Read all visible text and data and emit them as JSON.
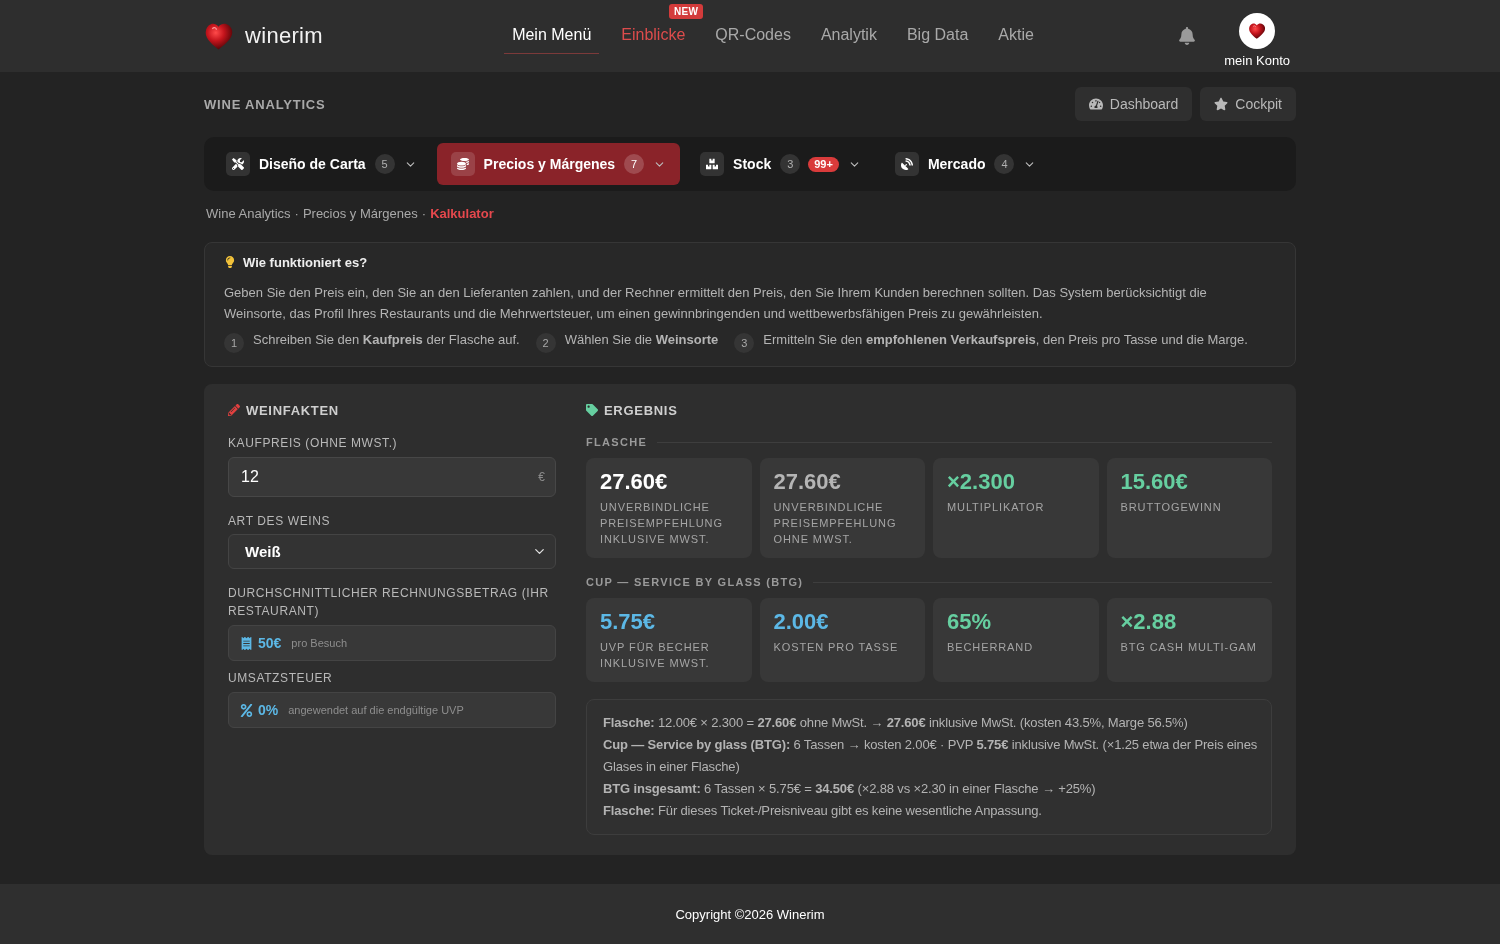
{
  "header": {
    "brand": "winerim",
    "nav": [
      {
        "label": "Mein Menü",
        "selected": true,
        "highlighted": false
      },
      {
        "label": "Einblicke",
        "selected": false,
        "highlighted": true,
        "badge": "NEW"
      },
      {
        "label": "QR-Codes",
        "selected": false,
        "highlighted": false
      },
      {
        "label": "Analytik",
        "selected": false,
        "highlighted": false
      },
      {
        "label": "Big Data",
        "selected": false,
        "highlighted": false
      },
      {
        "label": "Aktie",
        "selected": false,
        "highlighted": false
      }
    ],
    "account": "mein Konto"
  },
  "page": {
    "title": "WINE ANALYTICS",
    "actions": [
      "Dashboard",
      "Cockpit"
    ]
  },
  "tabs": [
    {
      "label": "Diseño de Carta",
      "count": "5",
      "selected": false
    },
    {
      "label": "Precios y Márgenes",
      "count": "7",
      "selected": true
    },
    {
      "label": "Stock",
      "count": "3",
      "alert": "99+",
      "selected": false
    },
    {
      "label": "Mercado",
      "count": "4",
      "selected": false
    }
  ],
  "breadcrumb": {
    "separator": "·",
    "items": [
      {
        "label": "Wine Analytics",
        "current": false
      },
      {
        "label": "Precios y Márgenes",
        "current": false
      },
      {
        "label": "Kalkulator",
        "current": true
      }
    ]
  },
  "info": {
    "title": "Wie funktioniert es?",
    "text": "Geben Sie den Preis ein, den Sie an den Lieferanten zahlen, und der Rechner ermittelt den Preis, den Sie Ihrem Kunden berechnen sollten. Das System berücksichtigt die Weinsorte, das Profil Ihres Restaurants und die Mehrwertsteuer, um einen gewinnbringenden und wettbewerbsfähigen Preis zu gewährleisten.",
    "steps": [
      {
        "number": "1",
        "text": "Schreiben Sie den **Kaufpreis** der Flasche auf."
      },
      {
        "number": "2",
        "text": "Wählen Sie die **Weinsorte**"
      },
      {
        "number": "3",
        "text": "Ermitteln Sie den **empfohlenen Verkaufspreis**, den Preis pro Tasse und die Marge."
      }
    ]
  },
  "form": {
    "title": "WEINFAKTEN",
    "fields": [
      {
        "kind": "input",
        "label": "KAUFPREIS (OHNE MWST.)",
        "value": "12",
        "suffix": "€"
      },
      {
        "kind": "select",
        "label": "ART DES WEINS",
        "value": "Weiß"
      },
      {
        "kind": "readout",
        "label": "DURCHSCHNITTLICHER RECHNUNGSBETRAG (IHR RESTAURANT)",
        "value": "50€",
        "note": "pro Besuch"
      },
      {
        "kind": "readout",
        "label": "UMSATZSTEUER",
        "value": "0%",
        "note": "angewendet auf die endgültige UVP"
      }
    ]
  },
  "result": {
    "title": "ERGEBNIS",
    "sections": [
      {
        "title": "FLASCHE",
        "metrics": [
          {
            "value": "27.60€",
            "label": "UNVERBINDLICHE PREISEMPFEHLUNG INKLUSIVE MWST.",
            "color": "#ffffff"
          },
          {
            "value": "27.60€",
            "label": "UNVERBINDLICHE PREISEMPFEHLUNG OHNE MWST.",
            "color": "#b4b4b4"
          },
          {
            "value": "×2.300",
            "label": "MULTIPLIKATOR",
            "color": "#66cfa0"
          },
          {
            "value": "15.60€",
            "label": "BRUTTOGEWINN",
            "color": "#66cfa0"
          }
        ]
      },
      {
        "title": "CUP — SERVICE BY GLASS (BTG)",
        "metrics": [
          {
            "value": "5.75€",
            "label": "UVP FÜR BECHER INKLUSIVE MWST.",
            "color": "#5cb8e6"
          },
          {
            "value": "2.00€",
            "label": "KOSTEN PRO TASSE",
            "color": "#5cb8e6"
          },
          {
            "value": "65%",
            "label": "BECHERRAND",
            "color": "#66cfa0"
          },
          {
            "value": "×2.88",
            "label": "BTG CASH MULTI-GAM",
            "color": "#66cfa0"
          }
        ]
      }
    ],
    "summary": [
      "**Flasche:** 12.00€ × 2.300 = **27.60€** ohne MwSt. → **27.60€** inklusive MwSt. (kosten 43.5%, Marge 56.5%)",
      "**Cup — Service by glass (BTG):** 6 Tassen → kosten 2.00€ · PVP **5.75€** inklusive MwSt. (×1.25 etwa der Preis eines Glases in einer Flasche)",
      "**BTG insgesamt:** 6 Tassen × 5.75€ = **34.50€** (×2.88 vs ×2.30 in einer Flasche → +25%)",
      "**Flasche:** Für dieses Ticket-/Preisniveau gibt es keine wesentliche Anpassung."
    ]
  },
  "footer": "Copyright ©2026 Winerim"
}
